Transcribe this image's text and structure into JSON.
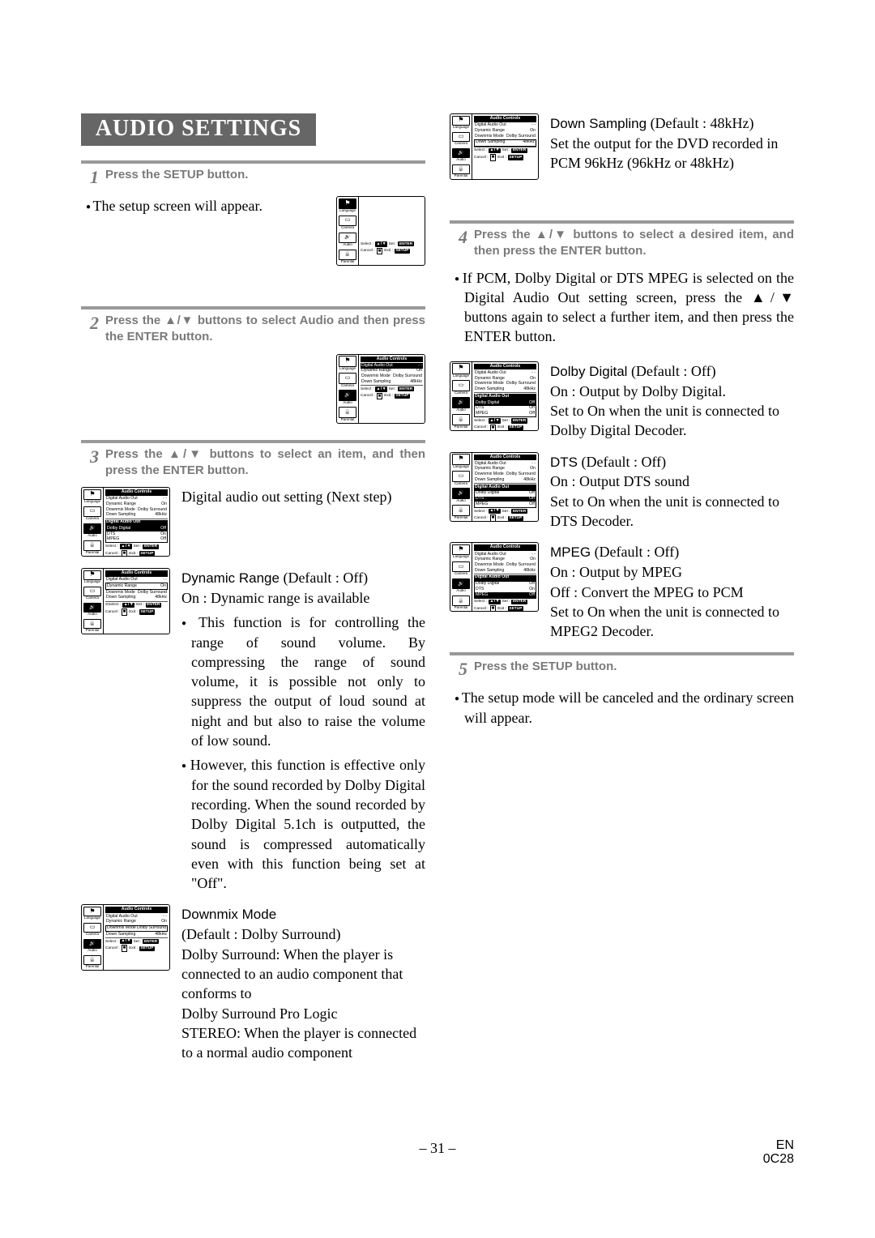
{
  "title": "AUDIO SETTINGS",
  "steps": {
    "s1": {
      "num": "1",
      "text": "Press the SETUP button."
    },
    "s2": {
      "num": "2",
      "text": "Press the ▲/▼ buttons to select Audio and then press the ENTER button."
    },
    "s3": {
      "num": "3",
      "text": "Press the ▲/▼ buttons to select an item, and then press the ENTER button."
    },
    "s4": {
      "num": "4",
      "text": "Press the ▲/▼ buttons to select a desired item, and then press the ENTER button."
    },
    "s5": {
      "num": "5",
      "text": "Press the SETUP button."
    }
  },
  "left": {
    "afterS1": "The setup screen will appear.",
    "dao": {
      "label": "Digital audio out setting (Next step)"
    },
    "dr": {
      "head": "Dynamic Range",
      "def": "(Default : Off)",
      "sub": "On : Dynamic range is available",
      "b1": "This function is for controlling the range of sound volume. By compressing the range of sound volume, it is possible not only to suppress the output of loud sound at night and but also to raise the volume of low sound.",
      "b2": "However, this function is effective only for the sound recorded by Dolby Digital recording. When the sound recorded by Dolby Digital 5.1ch is outputted, the sound is compressed automatically even with this function being set at \"Off\"."
    },
    "dm": {
      "head": "Downmix Mode",
      "def": "(Default : Dolby Surround)",
      "l1": "Dolby Surround: When the player is connected to an audio component that conforms to",
      "l2": "Dolby Surround Pro Logic",
      "l3": "STEREO: When the player is connected to a normal audio component"
    }
  },
  "right": {
    "ds": {
      "head": "Down Sampling",
      "def": "(Default : 48kHz)",
      "body": "Set the output for the DVD recorded in PCM 96kHz (96kHz or 48kHz)"
    },
    "afterS4": "If PCM, Dolby Digital or DTS MPEG is selected on the Digital Audio Out setting screen, press the ▲/▼ buttons again to select a further item, and then press the ENTER button.",
    "dd": {
      "head": "Dolby Digital",
      "def": "(Default : Off)",
      "l1": "On : Output by Dolby Digital.",
      "l2": "Set to On when the unit is connected to Dolby Digital Decoder."
    },
    "dts": {
      "head": "DTS",
      "def": "(Default : Off)",
      "l1": "On : Output DTS sound",
      "l2": "Set to On when the unit is connected to DTS Decoder."
    },
    "mpeg": {
      "head": "MPEG",
      "def": "(Default : Off)",
      "l1": "On : Output by MPEG",
      "l2": "Off : Convert the MPEG to PCM",
      "l3": "Set to On when the unit is connected to MPEG2 Decoder."
    },
    "afterS5": "The setup mode will be canceled and the ordinary screen will appear."
  },
  "osd": {
    "title": "Audio Controls",
    "sidebar": {
      "language": "Language",
      "camera": "Camera",
      "audio": "Audio",
      "parental": "Parental"
    },
    "rows": {
      "dao": "Digital Audio Out",
      "dr": "Dynamic Range",
      "dm": "Downmix Mode",
      "ds": "Down Sampling",
      "dd": "Dolby Digital",
      "dts": "DTS",
      "mpeg": "MPEG"
    },
    "vals": {
      "on": "On",
      "off": "Off",
      "ds": "Dolby Surround",
      "k48": "48kHz",
      "dash": "- -"
    },
    "subhead": "Digital Audio Out",
    "hints": {
      "select": "Select :",
      "set": "Set :",
      "enter": "ENTER",
      "cancel": "Cancel :",
      "exit": "Exit :",
      "setup": "SETUP"
    }
  },
  "footer": {
    "page": "– 31 –",
    "r1": "EN",
    "r2": "0C28"
  }
}
